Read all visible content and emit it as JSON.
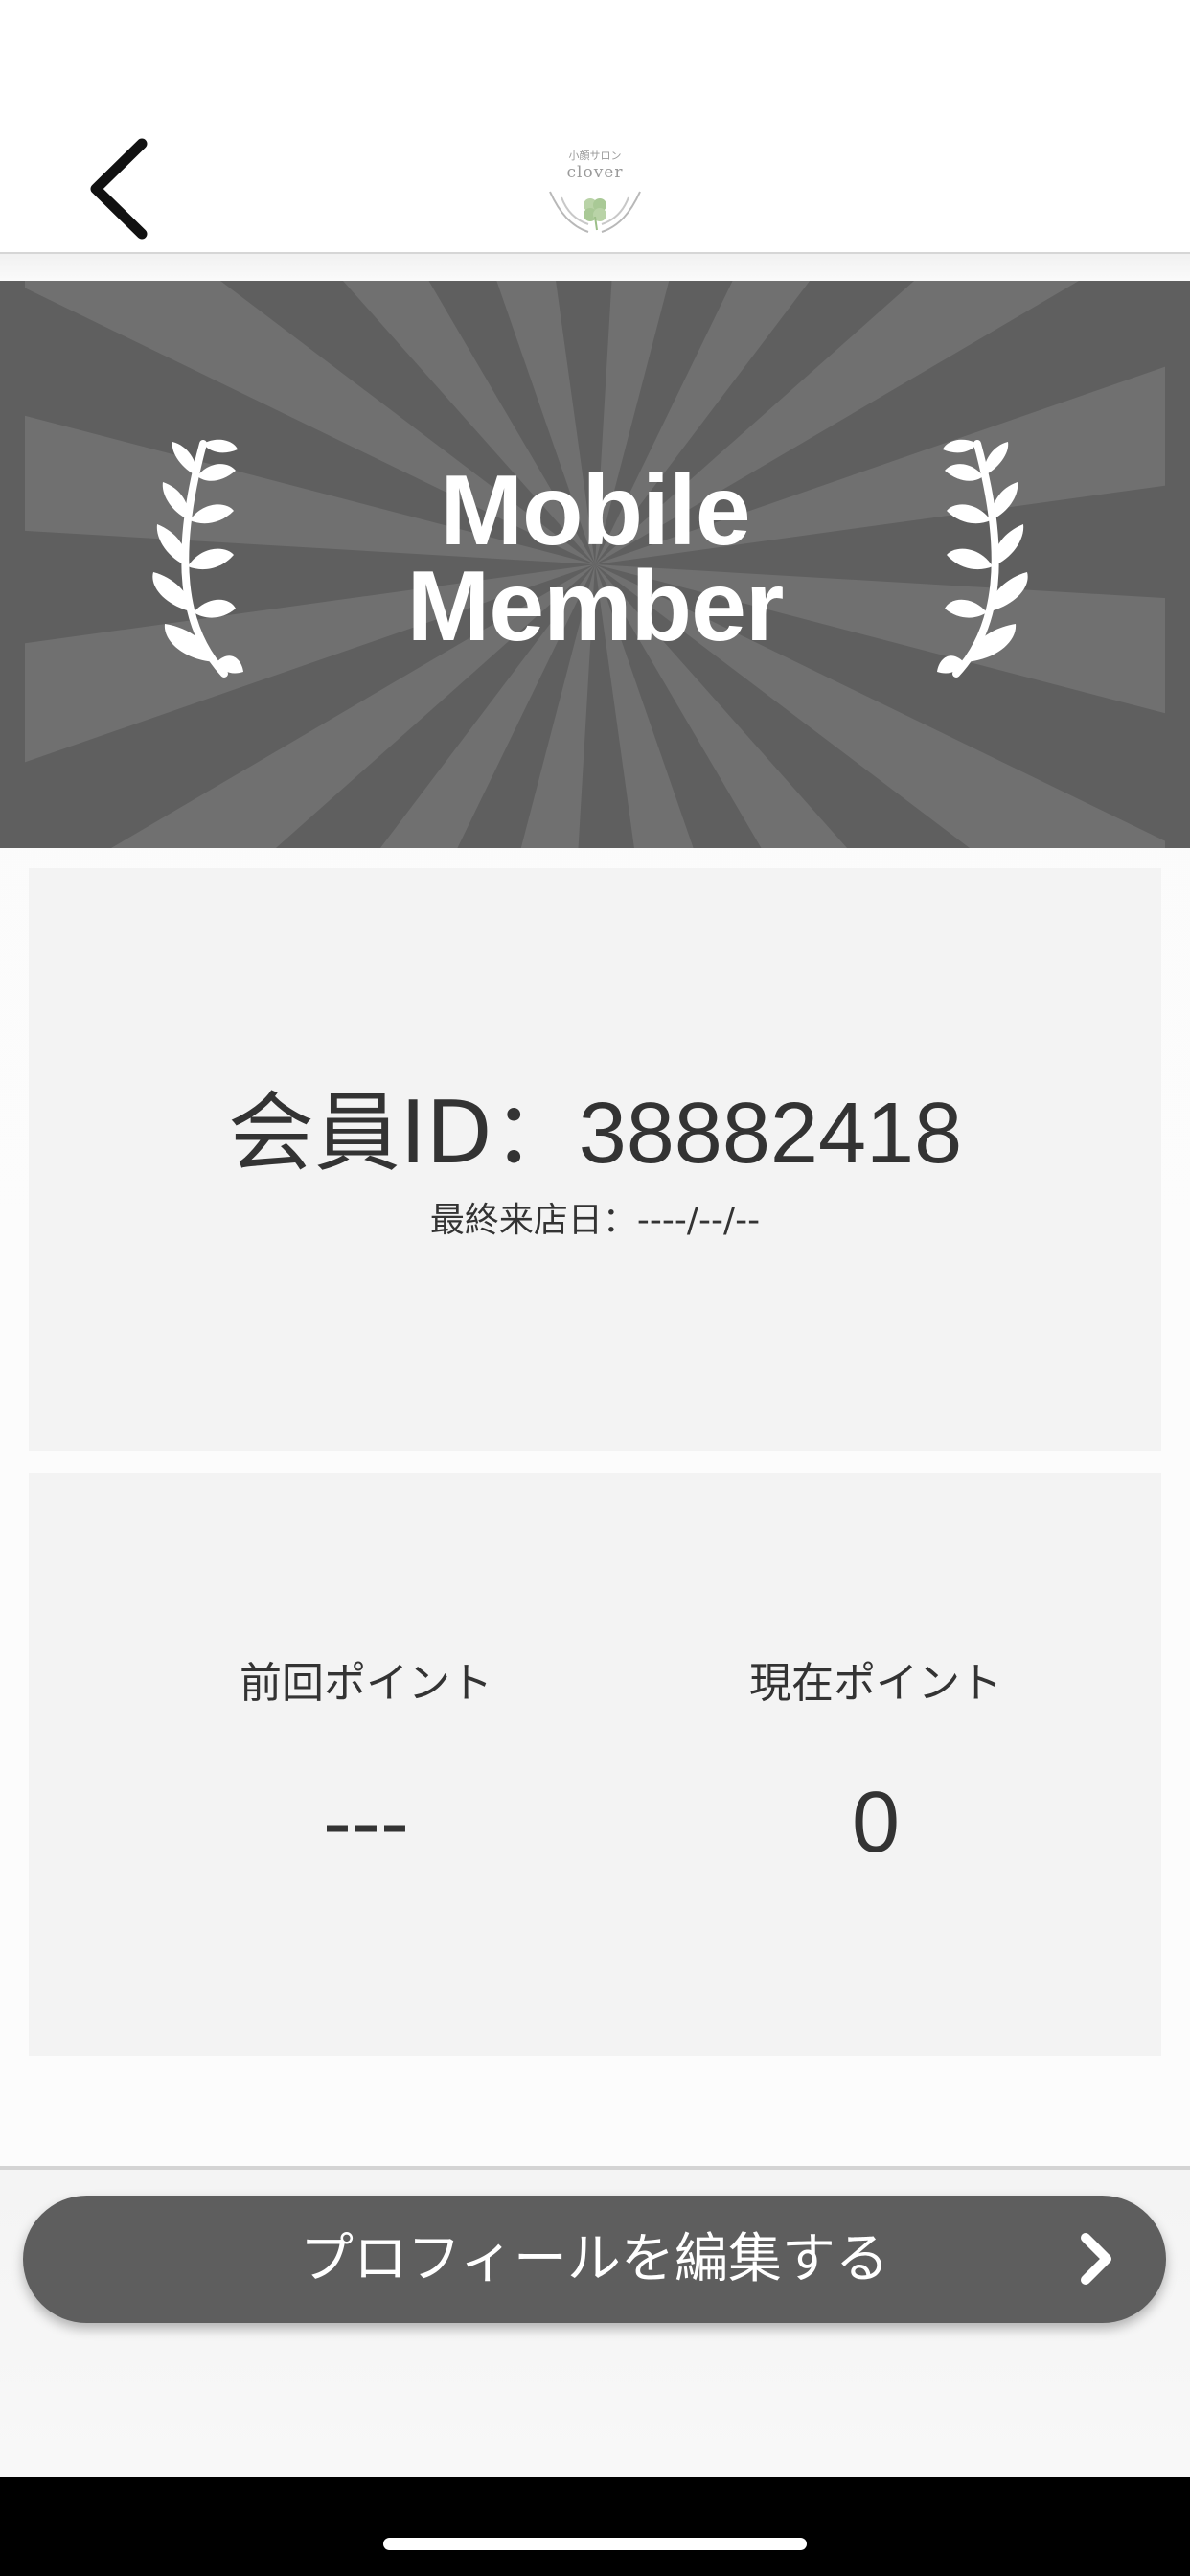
{
  "header": {
    "back_icon": "chevron-left-icon",
    "logo": {
      "small_text": "小顔サロン",
      "name": "clover",
      "icon": "clover-hands-icon"
    }
  },
  "banner": {
    "title_line1": "Mobile",
    "title_line2": "Member",
    "left_icon": "laurel-left-icon",
    "right_icon": "laurel-right-icon",
    "colors": {
      "dark": "#5f5f5f",
      "light": "#707070"
    }
  },
  "member_card": {
    "id_label": "会員ID：",
    "id_value": "38882418",
    "last_visit_label": "最終来店日：",
    "last_visit_value": "----/--/--"
  },
  "points_card": {
    "previous_label": "前回ポイント",
    "previous_value": "---",
    "current_label": "現在ポイント",
    "current_value": "0"
  },
  "footer": {
    "edit_profile_label": "プロフィールを編集する",
    "edit_profile_icon": "chevron-right-icon",
    "button_color": "#5e5e5e"
  }
}
